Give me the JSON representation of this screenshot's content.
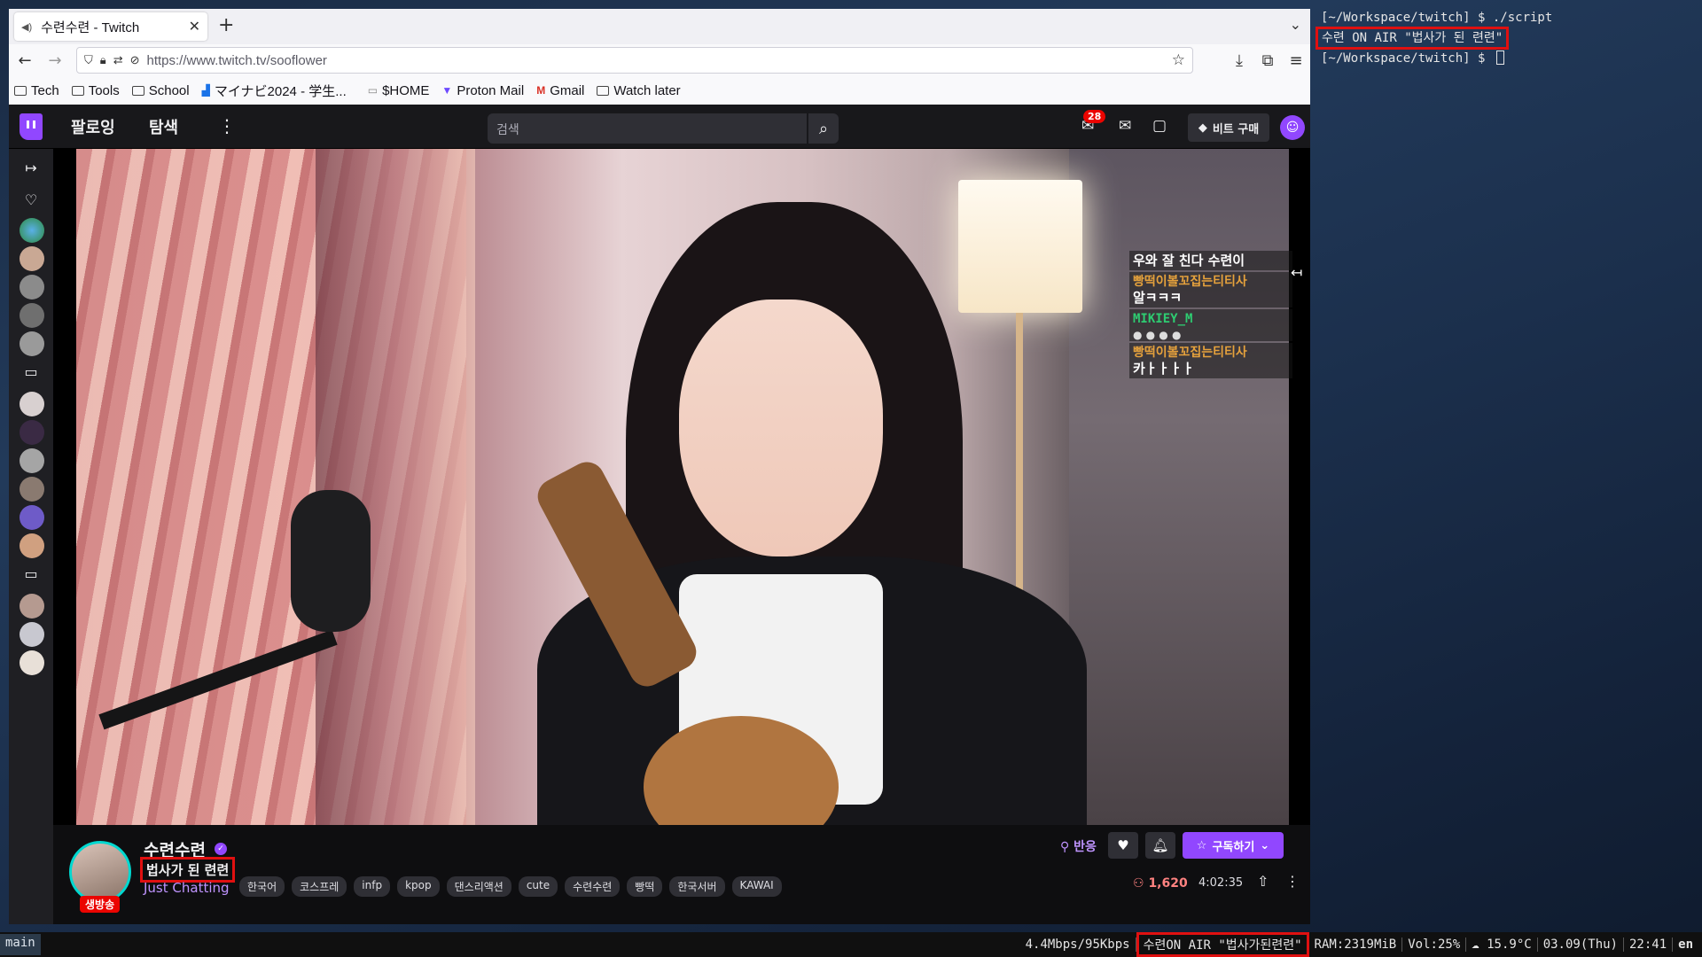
{
  "terminal": {
    "line1": "[~/Workspace/twitch] $ ./script",
    "line2": "수련 ON AIR \"법사가 된 련련\"",
    "line3": "[~/Workspace/twitch] $ "
  },
  "browser": {
    "tab_title": "수련수련 - Twitch",
    "url": "https://www.twitch.tv/sooflower",
    "bookmarks": [
      "Tech",
      "Tools",
      "School",
      "マイナビ2024 - 学生...",
      "$HOME",
      "Proton Mail",
      "Gmail",
      "Watch later"
    ]
  },
  "twitch": {
    "nav_following": "팔로잉",
    "nav_browse": "탐색",
    "search_placeholder": "검색",
    "notifications_count": "28",
    "bits_label": "비트 구매",
    "chat": [
      {
        "name": "",
        "text": "우와 잘 친다 수련이"
      },
      {
        "name": "빵떡이볼꼬집는티티사",
        "text": "알ㅋㅋㅋ"
      },
      {
        "name": "MIKIEY_M",
        "text": ""
      },
      {
        "name": "빵떡이볼꼬집는티티사",
        "text": "카ㅏㅏㅏㅏ"
      }
    ],
    "channel": {
      "name": "수련수련",
      "title": "법사가 된 련련",
      "live_label": "생방송",
      "category": "Just Chatting",
      "tags": [
        "한국어",
        "코스프레",
        "infp",
        "kpop",
        "댄스리액션",
        "cute",
        "수련수련",
        "빵떡",
        "한국서버",
        "KAWAI"
      ],
      "react_label": "반응",
      "subscribe_label": "구독하기",
      "viewers": "1,620",
      "uptime": "4:02:35"
    }
  },
  "statusbar": {
    "workspace": "main",
    "network": "4.4Mbps/95Kbps",
    "onair": "수련ON AIR \"법사가된련련\"",
    "ram": "RAM:2319MiB",
    "volume": "Vol:25%",
    "weather": "15.9°C",
    "date": "03.09(Thu)",
    "time": "22:41",
    "lang": "en"
  },
  "colors": {
    "twitch_purple": "#9147ff",
    "highlight_red": "#e01010",
    "live_red": "#eb0400"
  }
}
